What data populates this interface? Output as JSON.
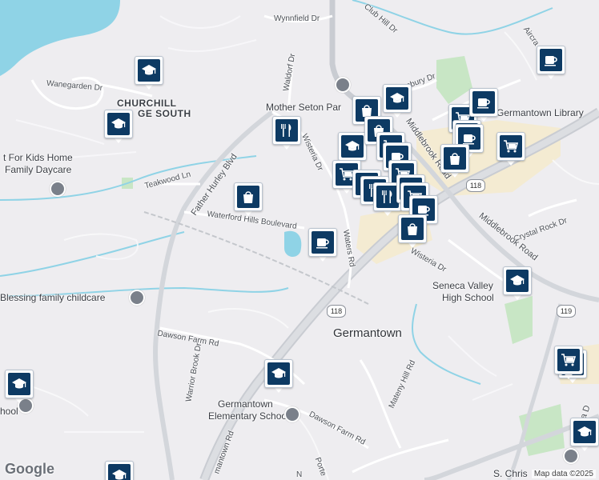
{
  "map": {
    "attribution": "Map data ©2025",
    "logo": "Google",
    "labels": {
      "wynnfield": "Wynnfield Dr",
      "club_hill": "Club Hill Dr",
      "aircraft": "Aircra",
      "waldorf": "Waldorf Dr",
      "wanegarden": "Wanegarden Dr",
      "churchill1": "CHURCHILL",
      "churchill2": "GE SOUTH",
      "locbury": "Locbury Dr",
      "mother_seton": "Mother Seton Par",
      "germantown_library": "Germantown Library",
      "daycare1": "t For Kids Home",
      "daycare2": "Family Daycare",
      "father_hurley": "Father Hurley Blvd",
      "teakwood": "Teakwood Ln",
      "wisteria1": "Wisteria Dr",
      "middlebrook1": "Middlebrook Road",
      "middlebrook2": "Middlebrook Road",
      "waterford": "Waterford Hills Boulevard",
      "waters": "Waters Rd",
      "crystal_rock": "Crystal Rock Dr",
      "wisteria2": "Wisteria Dr",
      "seneca1": "Seneca Valley",
      "seneca2": "High School",
      "blessing": "Blessing family childcare",
      "route118a": "118",
      "route118b": "118",
      "route119": "119",
      "germantown": "Germantown",
      "dawson_farm1": "Dawson Farm Rd",
      "warrior_brook": "Warrior Brook Dr",
      "mateny": "Mateny Hill Rd",
      "germantown_elem1": "Germantown",
      "germantown_elem2": "Elementary School",
      "dawson_farm2": "Dawson Farm Rd",
      "germantown_rd": "mantown Rd",
      "wisteria3": "Wisteria D",
      "porter": "Porte",
      "s_chris": "S. Chris",
      "school_left": "hool",
      "n_label": "N"
    },
    "markers": [
      {
        "type": "school",
        "name": "school-marker"
      },
      {
        "type": "shopping",
        "name": "shopping-marker"
      },
      {
        "type": "grocery",
        "name": "grocery-marker"
      },
      {
        "type": "cafe",
        "name": "cafe-marker"
      },
      {
        "type": "restaurant",
        "name": "restaurant-marker"
      }
    ]
  }
}
